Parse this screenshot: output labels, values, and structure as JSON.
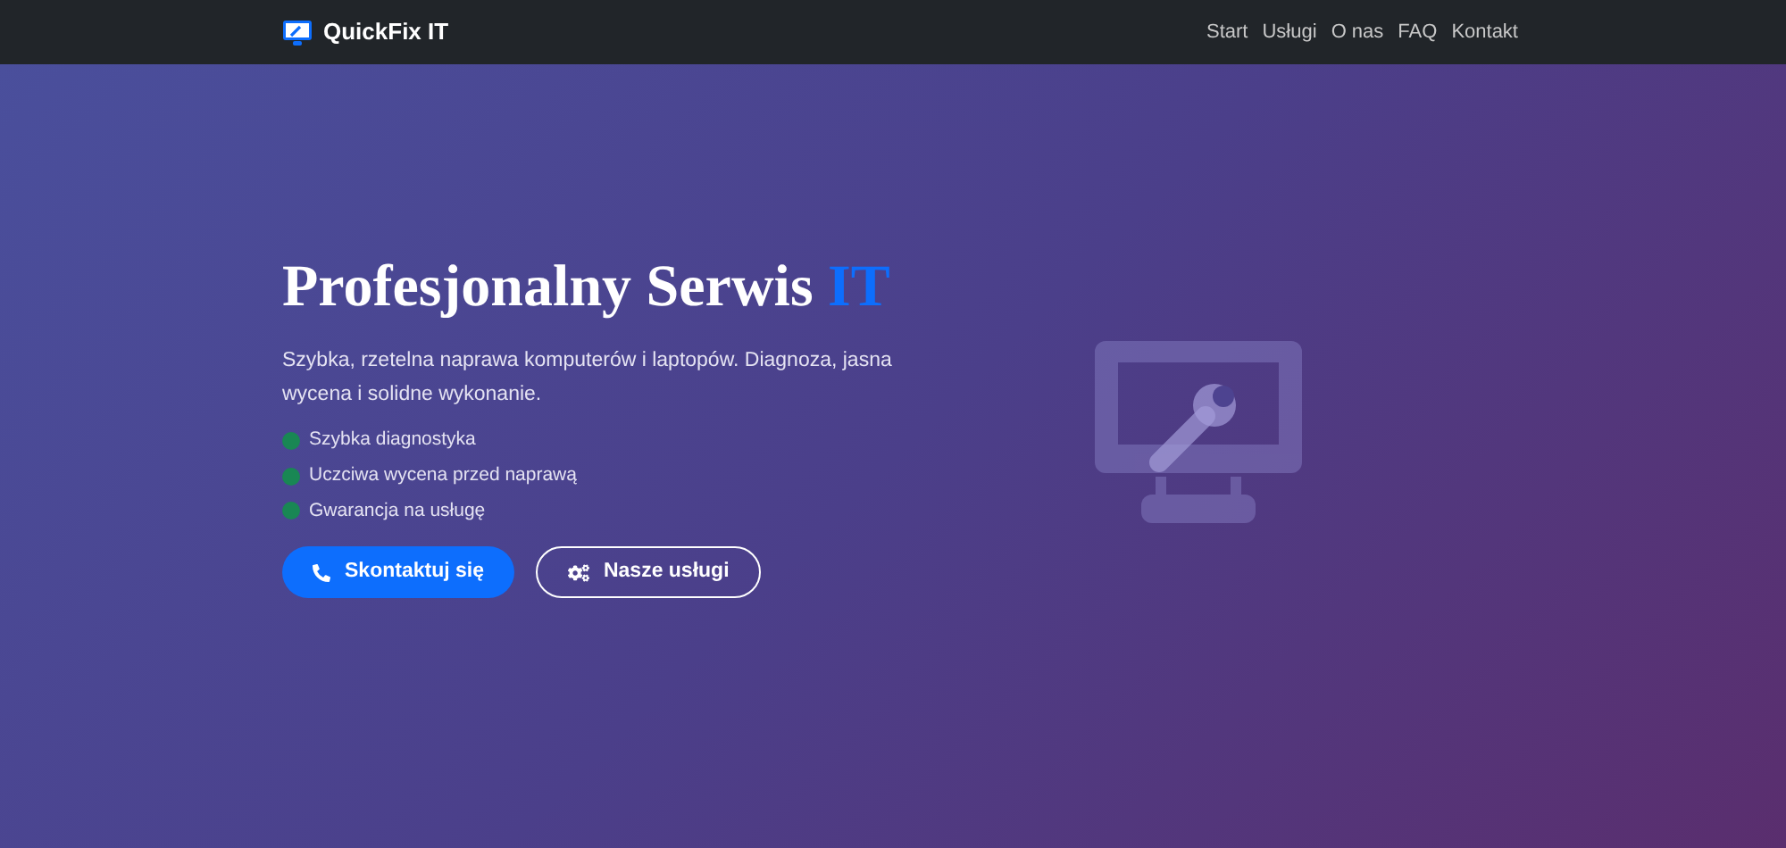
{
  "navbar": {
    "brand": "QuickFix IT",
    "links": [
      {
        "label": "Start"
      },
      {
        "label": "Usługi"
      },
      {
        "label": "O nas"
      },
      {
        "label": "FAQ"
      },
      {
        "label": "Kontakt"
      }
    ]
  },
  "hero": {
    "title": "Profesjonalny Serwis",
    "title_accent": "IT",
    "lead": "Szybka, rzetelna naprawa komputerów i laptopów. Diagnoza, jasna wycena i solidne wykonanie.",
    "features": [
      {
        "label": "Szybka diagnostyka",
        "color": "#198754"
      },
      {
        "label": "Uczciwa wycena przed naprawą",
        "color": "#198754"
      },
      {
        "label": "Gwarancja na usługę",
        "color": "#198754"
      }
    ],
    "buttons": [
      {
        "label": "Skontaktuj się",
        "kind": "primary"
      },
      {
        "label": "Nasze usługi",
        "kind": "outline"
      }
    ]
  }
}
